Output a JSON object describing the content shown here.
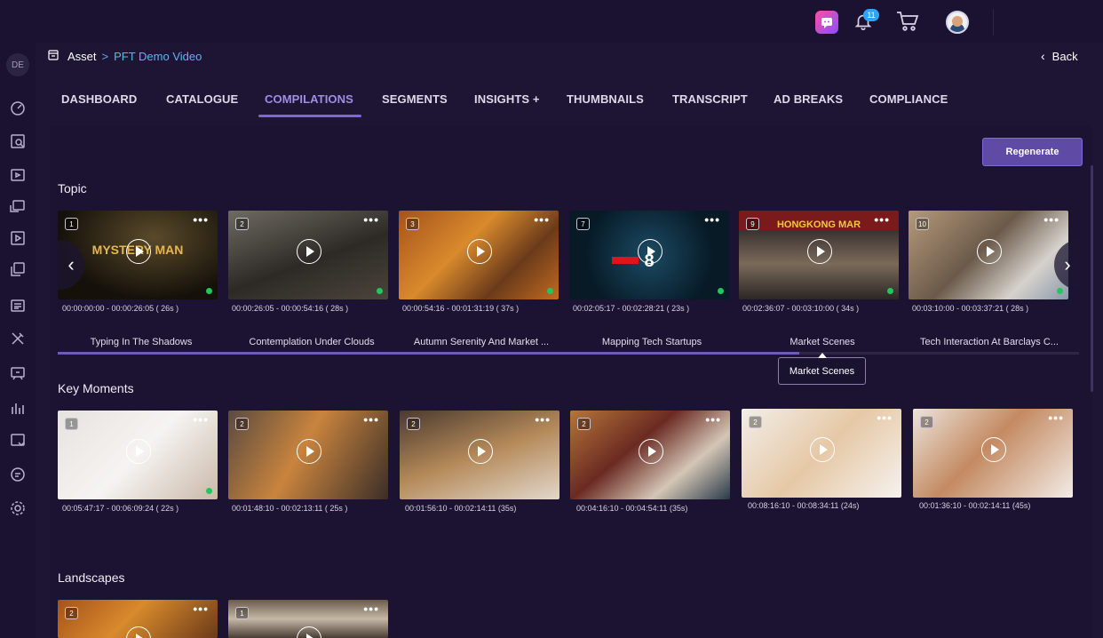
{
  "topbar": {
    "notification_count": "11"
  },
  "sidebar": {
    "avatar_initials": "DE",
    "icons": [
      "dashboard-icon",
      "search-doc-icon",
      "video-icon",
      "cast-icon",
      "film-icon",
      "media-stack-icon",
      "newspaper-icon",
      "tools-icon",
      "support-icon",
      "chart-icon",
      "crop-icon",
      "chat-icon",
      "settings-icon"
    ]
  },
  "breadcrumb": {
    "root": "Asset",
    "separator": ">",
    "current": "PFT Demo Video"
  },
  "back_label": "Back",
  "tabs": [
    {
      "label": "DASHBOARD"
    },
    {
      "label": "CATALOGUE"
    },
    {
      "label": "COMPILATIONS",
      "active": true
    },
    {
      "label": "SEGMENTS"
    },
    {
      "label": "INSIGHTS +"
    },
    {
      "label": "THUMBNAILS"
    },
    {
      "label": "TRANSCRIPT"
    },
    {
      "label": "AD BREAKS"
    },
    {
      "label": "COMPLIANCE"
    }
  ],
  "regenerate_label": "Regenerate",
  "sections": {
    "topic": {
      "title": "Topic",
      "cards": [
        {
          "num": "1",
          "time": "00:00:00:00 - 00:00:26:05  ( 26s )",
          "title": "Typing In The Shadows",
          "overlay": "MYSTERY MAN"
        },
        {
          "num": "2",
          "time": "00:00:26:05 - 00:00:54:16  ( 28s )",
          "title": "Contemplation Under Clouds"
        },
        {
          "num": "3",
          "time": "00:00:54:16 - 00:01:31:19  ( 37s )",
          "title": "Autumn Serenity And Market ..."
        },
        {
          "num": "7",
          "time": "00:02:05:17 - 00:02:28:21  ( 23s )",
          "title": "Mapping Tech Startups",
          "overlay": "8"
        },
        {
          "num": "9",
          "time": "00:02:36:07 - 00:03:10:00  ( 34s )",
          "title": "Market Scenes",
          "overlay": "HONGKONG MAR"
        },
        {
          "num": "10",
          "time": "00:03:10:00 - 00:03:37:21  ( 28s )",
          "title": "Tech Interaction At Barclays C..."
        }
      ],
      "tooltip": "Market Scenes"
    },
    "key_moments": {
      "title": "Key Moments",
      "cards": [
        {
          "num": "1",
          "time": "00:05:47:17 - 00:06:09:24  ( 22s )"
        },
        {
          "num": "2",
          "time": "00:01:48:10 - 00:02:13:11  ( 25s )"
        },
        {
          "num": "2",
          "time": "00:01:56:10 - 00:02:14:11  (35s)"
        },
        {
          "num": "2",
          "time": "00:04:16:10 - 00:04:54:11  (35s)"
        },
        {
          "num": "2",
          "time": "00:08:16:10 - 00:08:34:11  (24s)"
        },
        {
          "num": "2",
          "time": "00:01:36:10 - 00:02:14:11  (45s)"
        }
      ]
    },
    "landscapes": {
      "title": "Landscapes",
      "cards": [
        {
          "num": "2"
        },
        {
          "num": "1"
        }
      ]
    }
  },
  "colors": {
    "accent": "#7d66d6",
    "link": "#5ab6f5",
    "status_green": "#22c55e"
  }
}
